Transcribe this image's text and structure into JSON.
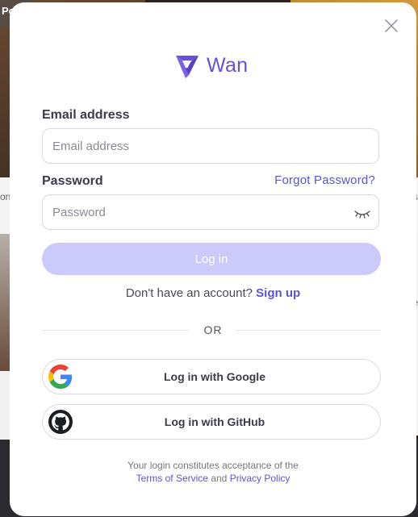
{
  "background": {
    "corner_label": "Po",
    "side_left_text": "on",
    "side_right_text": "s",
    "side_right_text2": "re"
  },
  "modal": {
    "logo_text": "Wan",
    "email_label": "Email address",
    "email_placeholder": "Email address",
    "email_value": "",
    "password_label": "Password",
    "forgot_password": "Forgot Password?",
    "password_placeholder": "Password",
    "password_value": "",
    "login_button": "Log in",
    "signup_prompt": "Don't have an account?",
    "signup_link": "Sign up",
    "or_text": "OR",
    "google_button": "Log in with Google",
    "github_button": "Log in with GitHub",
    "legal_text": "Your login constitutes acceptance of the",
    "terms_link": "Terms of Service",
    "and_text": "and",
    "privacy_link": "Privacy Policy"
  },
  "icons": {
    "close": "close-icon",
    "logo": "wan-logo-icon",
    "eye": "eye-closed-icon",
    "google": "google-icon",
    "github": "github-icon"
  },
  "colors": {
    "accent": "#5b54d6",
    "login_button_disabled": "#cccafa",
    "logo": "#6a4fd8"
  }
}
